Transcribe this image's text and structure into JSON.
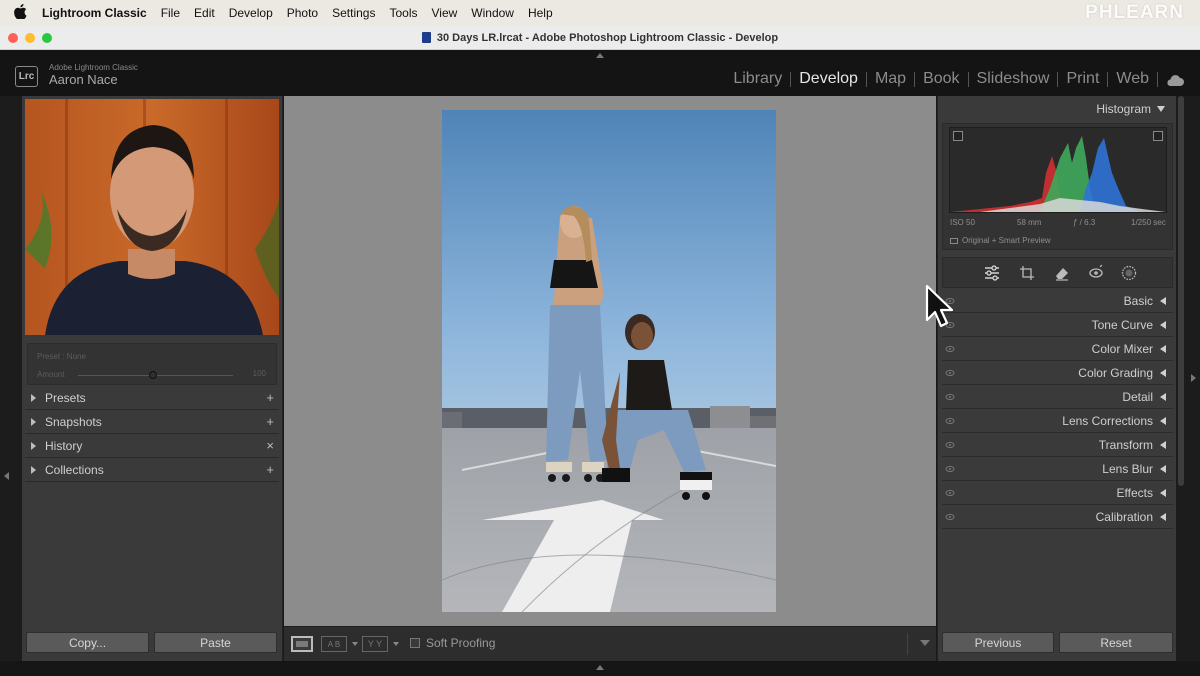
{
  "menubar": {
    "app_name": "Lightroom Classic",
    "items": [
      "File",
      "Edit",
      "Develop",
      "Photo",
      "Settings",
      "Tools",
      "View",
      "Window",
      "Help"
    ],
    "watermark": "PHLEARN"
  },
  "window": {
    "title": "30 Days LR.lrcat - Adobe Photoshop Lightroom Classic - Develop"
  },
  "identity": {
    "badge": "Lrc",
    "app_label": "Adobe Lightroom Classic",
    "user_name": "Aaron Nace"
  },
  "modules": {
    "items": [
      "Library",
      "Develop",
      "Map",
      "Book",
      "Slideshow",
      "Print",
      "Web"
    ],
    "active": "Develop"
  },
  "left_panel": {
    "preset_label": "Preset : None",
    "amount_label": "Amount",
    "amount_value": "100",
    "amount_fraction": 0.5,
    "sections": [
      {
        "label": "Presets",
        "action": "+"
      },
      {
        "label": "Snapshots",
        "action": "+"
      },
      {
        "label": "History",
        "action": "×"
      },
      {
        "label": "Collections",
        "action": "+"
      }
    ],
    "copy_label": "Copy...",
    "paste_label": "Paste"
  },
  "toolbar": {
    "ab_label": "A B",
    "yy_label": "Y Y",
    "soft_proofing_label": "Soft Proofing",
    "soft_proofing_checked": false
  },
  "right_panel": {
    "histogram_title": "Histogram",
    "exif": {
      "iso": "ISO 50",
      "focal": "58 mm",
      "aperture": "ƒ / 6.3",
      "shutter": "1/250 sec"
    },
    "preview_status": "Original + Smart Preview",
    "tools": [
      "sliders-icon",
      "crop-icon",
      "eraser-icon",
      "red-eye-icon",
      "mask-icon"
    ],
    "sections": [
      "Basic",
      "Tone Curve",
      "Color Mixer",
      "Color Grading",
      "Detail",
      "Lens Corrections",
      "Transform",
      "Lens Blur",
      "Effects",
      "Calibration"
    ],
    "previous_label": "Previous",
    "reset_label": "Reset"
  },
  "colors": {
    "panel": "#3a3a3a",
    "canvas": "#8c8c8c",
    "module_active": "#e6e6e6",
    "module_inactive": "#8c8c8c"
  }
}
